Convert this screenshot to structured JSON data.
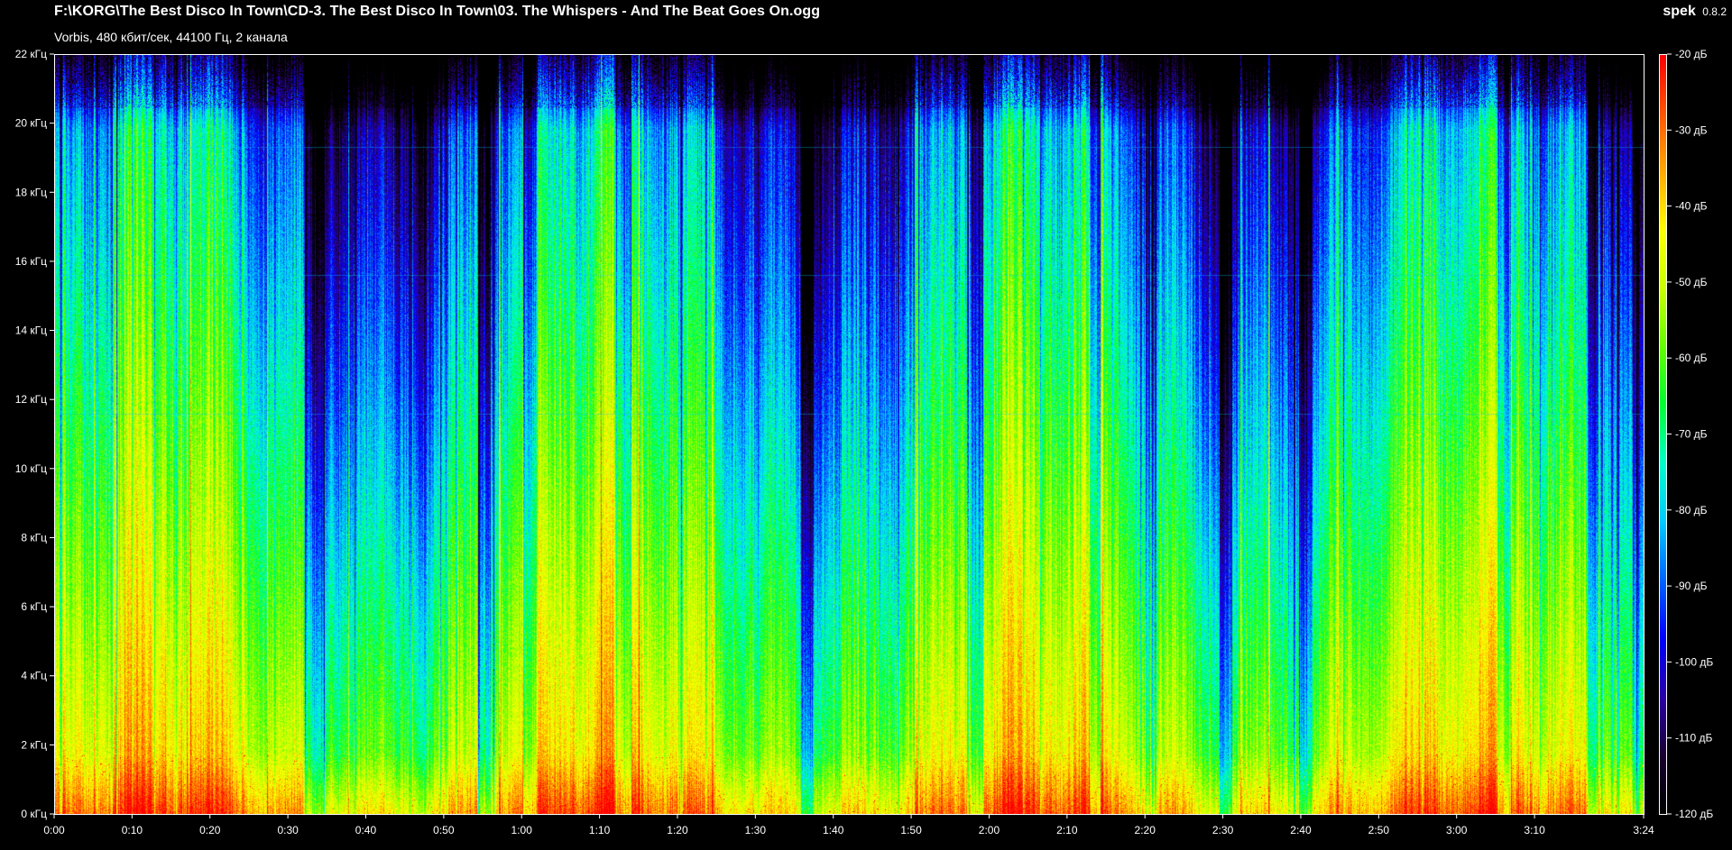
{
  "window": {
    "title": "F:\\KORG\\The Best Disco In Town\\CD-3. The Best Disco In Town\\03. The Whispers - And The Beat Goes On.ogg",
    "subtitle": "Vorbis, 480 кбит/сек, 44100 Гц, 2 канала",
    "brand_name": "spek",
    "brand_version": "0.8.2"
  },
  "chart_data": {
    "type": "heatmap",
    "frequency_axis": {
      "range_khz": [
        0,
        22
      ],
      "tick_labels": [
        "0 кГц",
        "2 кГц",
        "4 кГц",
        "6 кГц",
        "8 кГц",
        "10 кГц",
        "12 кГц",
        "14 кГц",
        "16 кГц",
        "18 кГц",
        "20 кГц",
        "22 кГц"
      ],
      "tick_values_khz": [
        0,
        2,
        4,
        6,
        8,
        10,
        12,
        14,
        16,
        18,
        20,
        22
      ]
    },
    "time_axis": {
      "duration_seconds": 204,
      "tick_labels": [
        "0:00",
        "0:10",
        "0:20",
        "0:30",
        "0:40",
        "0:50",
        "1:00",
        "1:10",
        "1:20",
        "1:30",
        "1:40",
        "1:50",
        "2:00",
        "2:10",
        "2:20",
        "2:30",
        "2:40",
        "2:50",
        "3:00",
        "3:10",
        "3:24"
      ],
      "tick_values_seconds": [
        0,
        10,
        20,
        30,
        40,
        50,
        60,
        70,
        80,
        90,
        100,
        110,
        120,
        130,
        140,
        150,
        160,
        170,
        180,
        190,
        204
      ]
    },
    "level_axis": {
      "range_db": [
        -120,
        -20
      ],
      "tick_labels": [
        "-20 дБ",
        "-30 дБ",
        "-40 дБ",
        "-50 дБ",
        "-60 дБ",
        "-70 дБ",
        "-80 дБ",
        "-90 дБ",
        "-100 дБ",
        "-110 дБ",
        "-120 дБ"
      ],
      "tick_values_db": [
        -20,
        -30,
        -40,
        -50,
        -60,
        -70,
        -80,
        -90,
        -100,
        -110,
        -120
      ]
    },
    "palette": [
      "#000000",
      "#1a0033",
      "#2a00aa",
      "#0000ff",
      "#0066ff",
      "#00ccff",
      "#00ffcc",
      "#00ff33",
      "#66ff00",
      "#ccff00",
      "#ffff00",
      "#ffaa00",
      "#ff5500",
      "#ff0000"
    ]
  }
}
